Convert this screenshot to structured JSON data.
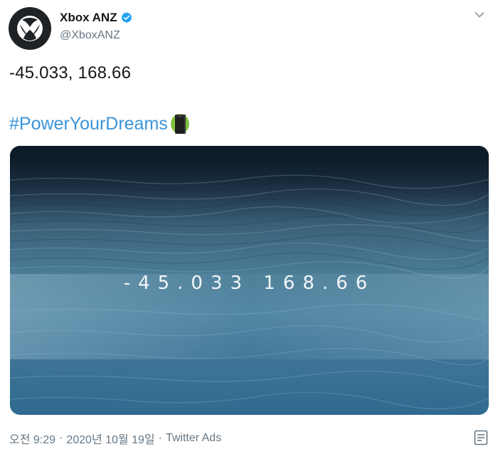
{
  "account": {
    "display_name": "Xbox ANZ",
    "handle": "@XboxANZ",
    "verified": true,
    "avatar_icon": "xbox-logo-icon"
  },
  "tweet": {
    "text": "-45.033, 168.66",
    "hashtag": "#PowerYourDreams",
    "emoji_icon": "xbox-series-x-console-icon"
  },
  "media": {
    "caption": "-45.033 168.66"
  },
  "footer": {
    "time": "오전 9:29",
    "separator": "·",
    "date": "2020년 10월 19일",
    "source": "Twitter Ads"
  },
  "icons": {
    "more": "chevron-down-icon",
    "analytics": "analytics-icon"
  },
  "colors": {
    "link": "#3b94d9",
    "verified": "#1da1f2",
    "muted": "#657786",
    "avatar_bg": "#1f2326"
  }
}
